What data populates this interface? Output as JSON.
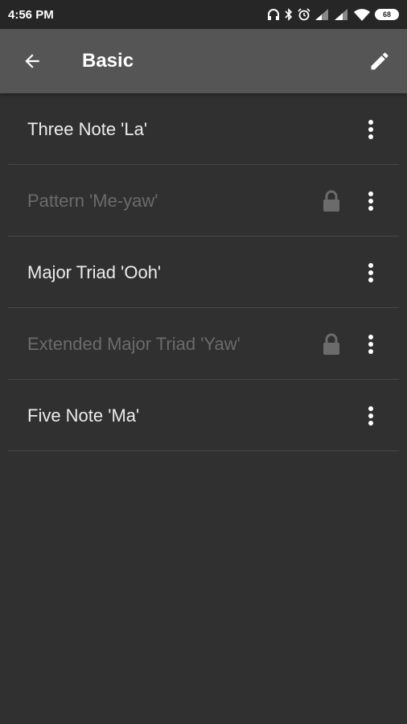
{
  "status": {
    "time": "4:56 PM",
    "battery": "68"
  },
  "appbar": {
    "title": "Basic",
    "back_icon": "arrow-back-icon",
    "edit_icon": "pencil-icon"
  },
  "items": [
    {
      "label": "Three Note 'La'",
      "locked": false
    },
    {
      "label": "Pattern 'Me-yaw'",
      "locked": true
    },
    {
      "label": "Major Triad 'Ooh'",
      "locked": false
    },
    {
      "label": "Extended Major Triad 'Yaw'",
      "locked": true
    },
    {
      "label": "Five Note 'Ma'",
      "locked": false
    }
  ],
  "colors": {
    "background": "#303030",
    "appbar": "#555555",
    "statusbar": "#262626",
    "locked_text": "#6b6b6b"
  }
}
